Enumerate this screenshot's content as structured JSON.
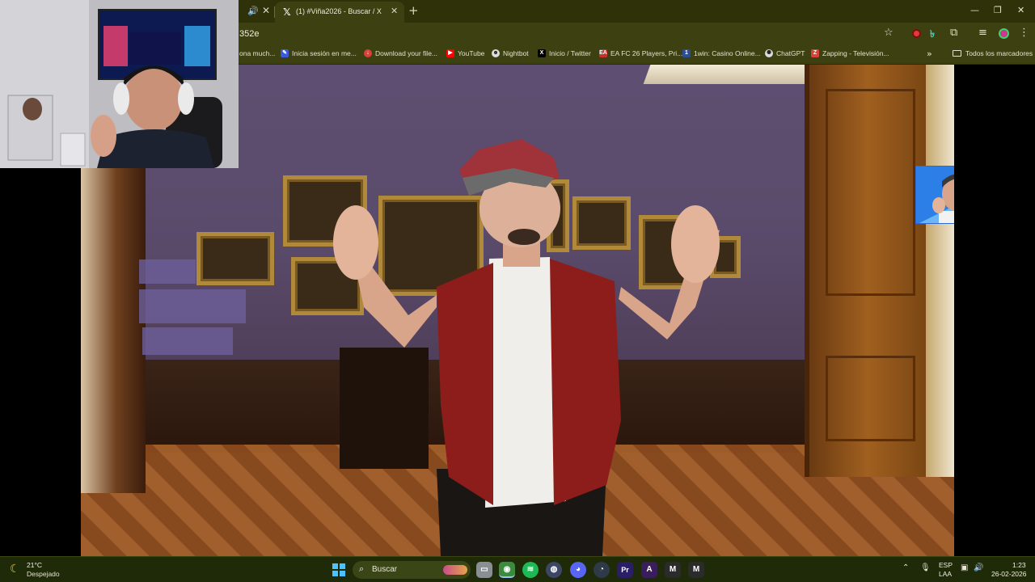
{
  "browser": {
    "tab": {
      "title": "(1) #Viña2026 - Buscar / X",
      "favicon": "x-logo-icon"
    },
    "url_fragment": "352e",
    "bookmarks": [
      {
        "label": "ona much...",
        "icon": "bookmark-icon"
      },
      {
        "label": "Inicia sesión en me...",
        "icon": "login-icon",
        "color": "#3b5ad9"
      },
      {
        "label": "Download your file...",
        "icon": "download-icon",
        "color": "#d9413b"
      },
      {
        "label": "YouTube",
        "icon": "youtube-icon",
        "color": "#ff0000"
      },
      {
        "label": "Nightbot",
        "icon": "nightbot-icon",
        "color": "#dddddd"
      },
      {
        "label": "Inicio / Twitter",
        "icon": "x-logo-icon",
        "color": "#000000"
      },
      {
        "label": "EA FC 26 Players, Pri...",
        "icon": "ea-fc-icon",
        "color": "#c9302c"
      },
      {
        "label": "1win: Casino Online...",
        "icon": "casino-icon",
        "color": "#2a4d9c"
      },
      {
        "label": "ChatGPT",
        "icon": "chatgpt-icon",
        "color": "#dddddd"
      },
      {
        "label": "Zapping - Televisión...",
        "icon": "zapping-icon",
        "color": "#d9413b"
      }
    ],
    "bookmarks_folder": "Todos los marcadores"
  },
  "taskbar": {
    "weather": {
      "temp": "21°C",
      "desc": "Despejado",
      "icon": "moon-icon"
    },
    "search_label": "Buscar",
    "apps": [
      {
        "name": "file-explorer-icon",
        "color": "#8a8f96",
        "glyph": "▭"
      },
      {
        "name": "chrome-icon",
        "color": "#3b8b3f",
        "glyph": "◉"
      },
      {
        "name": "spotify-icon",
        "color": "#1db954",
        "glyph": "≋"
      },
      {
        "name": "obs-icon",
        "color": "#3c4766",
        "glyph": "◍"
      },
      {
        "name": "discord-icon",
        "color": "#5865f2",
        "glyph": "◕"
      },
      {
        "name": "streaming-app-icon",
        "color": "#2f3a48",
        "glyph": "◔"
      },
      {
        "name": "premiere-icon",
        "color": "#2a1e66",
        "glyph": "Pr"
      },
      {
        "name": "affinity-icon",
        "color": "#3a1d5c",
        "glyph": "A"
      },
      {
        "name": "media-app-icon",
        "color": "#2b2b2b",
        "glyph": "M"
      },
      {
        "name": "media-app-2-icon",
        "color": "#2b2b2b",
        "glyph": "M"
      }
    ],
    "tray": {
      "lang": "ESP",
      "layout": "LAA",
      "time": "1:23",
      "date": "26-02-2026"
    }
  }
}
